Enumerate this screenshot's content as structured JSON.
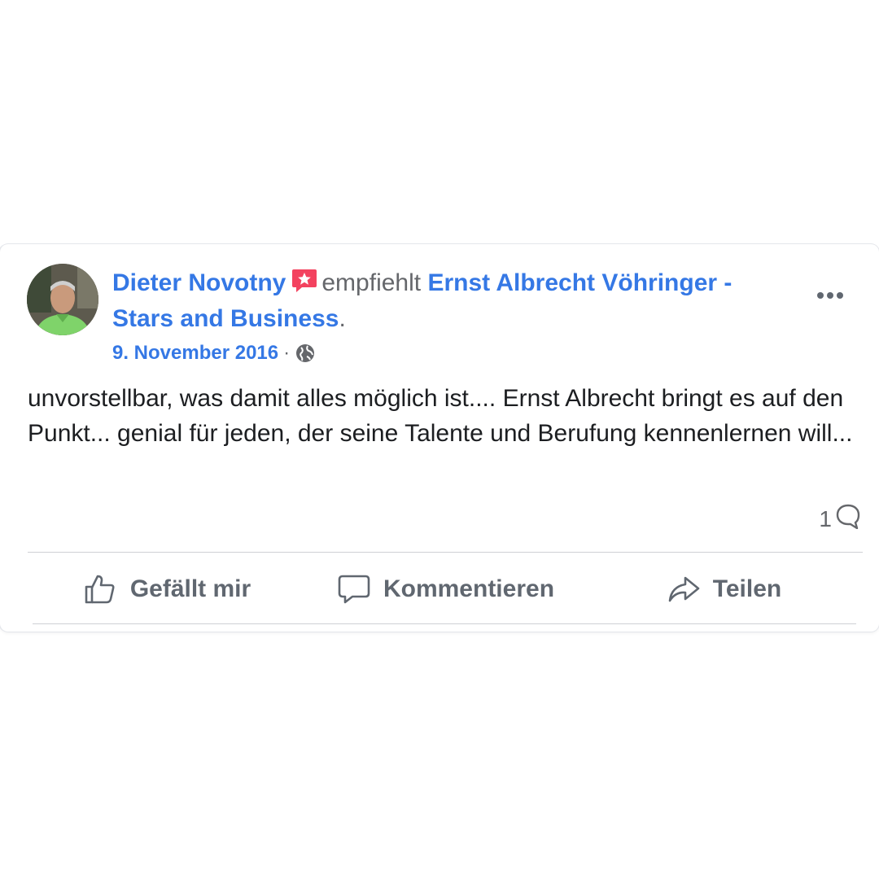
{
  "post": {
    "author": "Dieter Novotny",
    "action": "empfiehlt",
    "page_name": "Ernst Albrecht Vöhringer - Stars and Business",
    "period": ".",
    "date": "9. November 2016",
    "separator": "·",
    "body": "unvorstellbar, was damit alles möglich ist.... Ernst Albrecht bringt es auf den Punkt... genial für jeden, der seine Talente und Berufung kennenlernen will...",
    "comment_count": "1"
  },
  "actions": {
    "like_label": "Gefällt mir",
    "comment_label": "Kommentieren",
    "share_label": "Teilen"
  },
  "icons": {
    "recommend": "recommend-star-icon",
    "audience": "globe-icon",
    "more": "more-options-icon",
    "comment_count": "comment-bubble-icon",
    "like": "thumbs-up-icon",
    "comment": "comment-icon",
    "share": "share-arrow-icon"
  },
  "colors": {
    "link": "#3578e5",
    "recommend_badge": "#f3425f",
    "secondary_text": "#65676b",
    "body_text": "#1c1e21"
  }
}
